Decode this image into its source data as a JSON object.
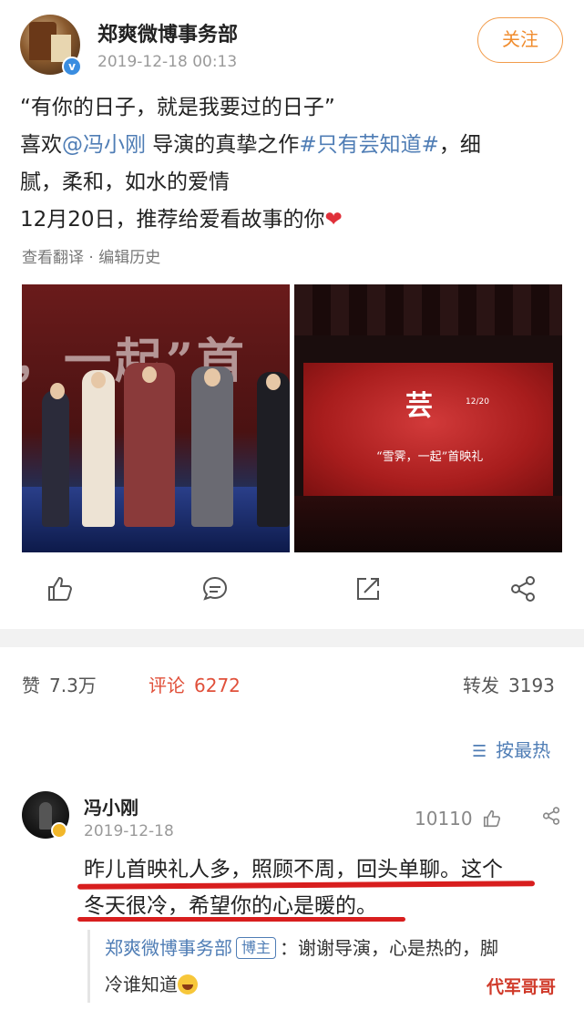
{
  "post": {
    "author": "郑爽微博事务部",
    "time": "2019-12-18 00:13",
    "follow_label": "关注",
    "line1": "“有你的日子，就是我要过的日子”",
    "line2_prefix": "喜欢",
    "mention": "@冯小刚",
    "line2_mid": " 导演的真挚之作",
    "hashtag": "#只有芸知道#",
    "line2_suffix": "，细",
    "line3": "腻，柔和，如水的爱情",
    "line4": "12月20日，推荐给爱看故事的你",
    "translate_label": "查看翻译",
    "meta_sep": " · ",
    "history_label": "编辑历史"
  },
  "photos": {
    "banner": "，一起”首",
    "screen_title": "芸",
    "screen_sub": "“雪霁，一起”首映礼",
    "screen_date": "12/20"
  },
  "actions": [
    "like-icon",
    "comment-icon",
    "repost-icon",
    "share-icon"
  ],
  "stats": {
    "like_label": "赞",
    "like_count": "7.3万",
    "comment_label": "评论",
    "comment_count": "6272",
    "repost_label": "转发",
    "repost_count": "3193"
  },
  "sort_label": "按最热",
  "comment": {
    "name": "冯小刚",
    "time": "2019-12-18",
    "likes": "10110",
    "line1": "昨儿首映礼人多，照顾不周，回头单聊。这个",
    "line2": "冬天很冷，希望你的心是暖的。"
  },
  "reply": {
    "name": "郑爽微博事务部",
    "tag": "博主",
    "text1": "：谢谢导演，心是热的，脚",
    "text2": "冷谁知道"
  },
  "watermark": "代军哥哥",
  "colors": {
    "link": "#4f7db5",
    "accent": "#f08c2e",
    "comment_highlight": "#e0503a",
    "underline": "#d81e1e"
  }
}
